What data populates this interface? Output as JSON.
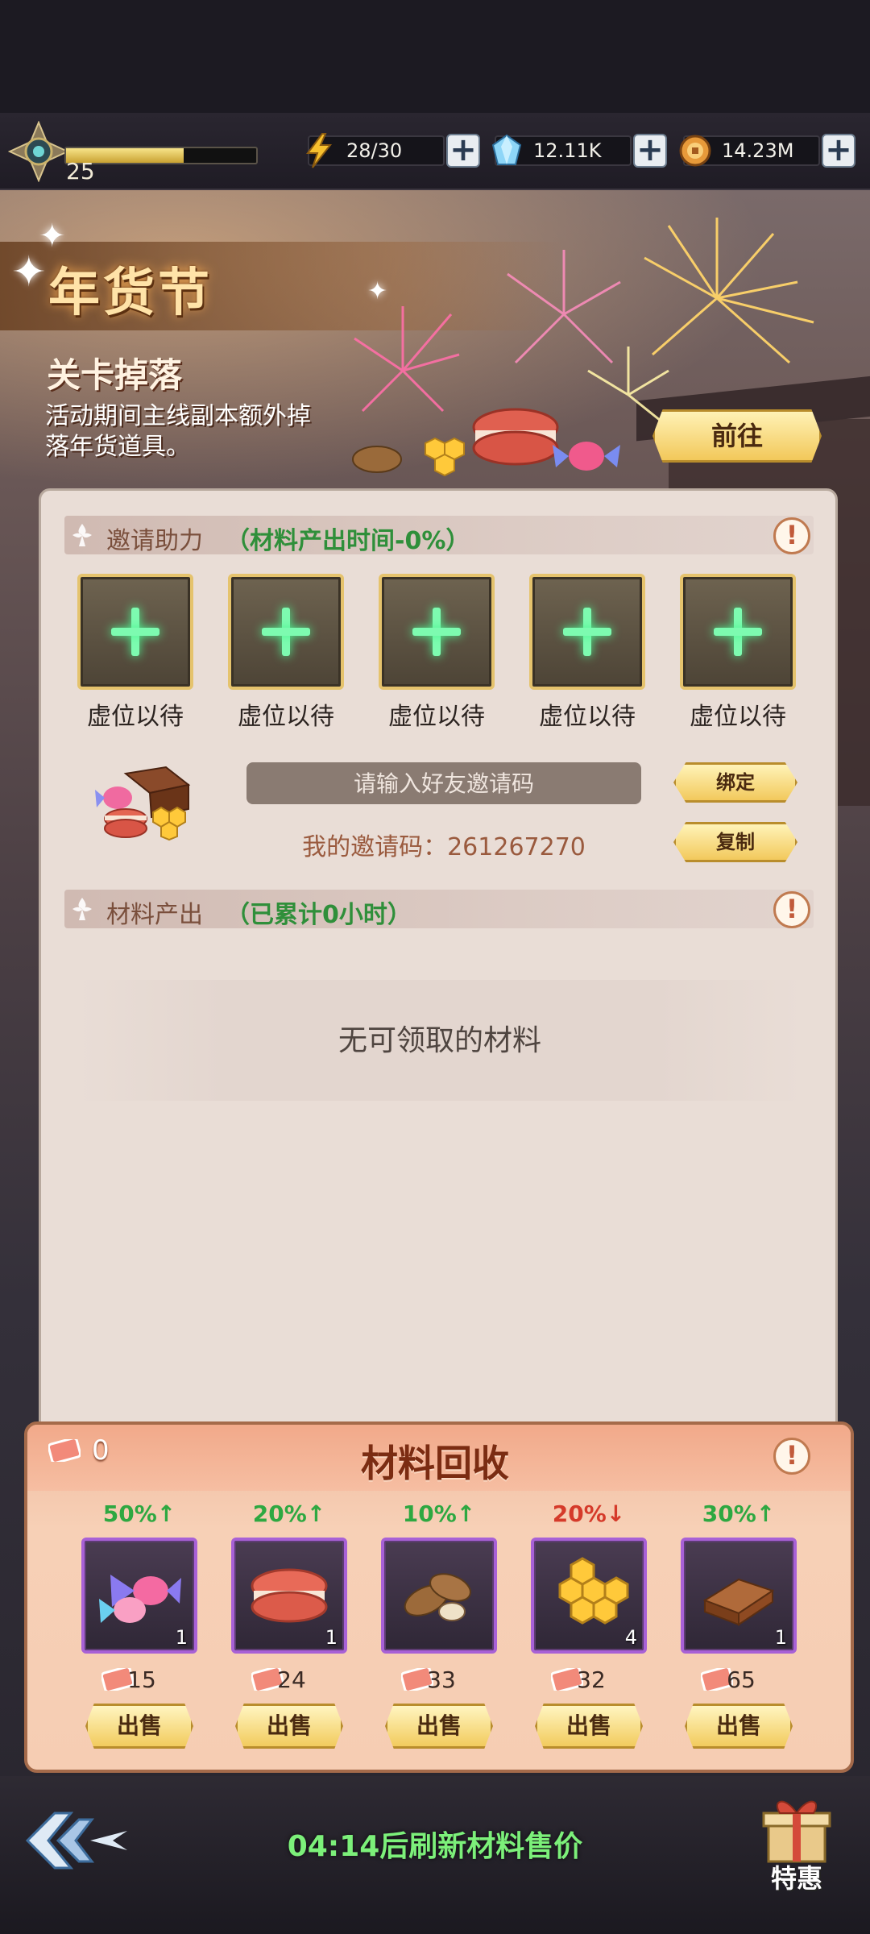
{
  "resources": {
    "level": "25",
    "xp_fraction": 0.62,
    "energy": "28/30",
    "gems": "12.11K",
    "coins": "14.23M"
  },
  "banner": {
    "title": "年货节",
    "drop_title": "关卡掉落",
    "drop_desc": "活动期间主线副本额外掉落年货道具。",
    "go_button": "前往"
  },
  "invite": {
    "title": "邀请助力",
    "subtitle": "（材料产出时间-0%）",
    "slots": [
      "虚位以待",
      "虚位以待",
      "虚位以待",
      "虚位以待",
      "虚位以待"
    ],
    "input_placeholder": "请输入好友邀请码",
    "my_code_label": "我的邀请码：261267270",
    "bind_button": "绑定",
    "copy_button": "复制"
  },
  "output": {
    "title": "材料产出",
    "subtitle": "（已累计0小时）",
    "empty_text": "无可领取的材料"
  },
  "recycle": {
    "title": "材料回收",
    "tickets": "0",
    "items": [
      {
        "name": "candy-icon",
        "percent": "50%↑",
        "trend": "up",
        "count": "1",
        "price": "15",
        "sell": "出售"
      },
      {
        "name": "macaron-icon",
        "percent": "20%↑",
        "trend": "up",
        "count": "1",
        "price": "24",
        "sell": "出售"
      },
      {
        "name": "almond-icon",
        "percent": "10%↑",
        "trend": "up",
        "count": "",
        "price": "33",
        "sell": "出售"
      },
      {
        "name": "honeycomb-icon",
        "percent": "20%↓",
        "trend": "down",
        "count": "4",
        "price": "32",
        "sell": "出售"
      },
      {
        "name": "chocolate-icon",
        "percent": "30%↑",
        "trend": "up",
        "count": "1",
        "price": "65",
        "sell": "出售"
      }
    ]
  },
  "footer": {
    "refresh_text": "04:14后刷新材料售价",
    "gift_label": "特惠"
  },
  "colors": {
    "accent_green": "#7cf07a",
    "up_green": "#2ea841",
    "down_red": "#d53a2a",
    "gold": "#f2c85a",
    "purple_frame": "#a861d6"
  }
}
